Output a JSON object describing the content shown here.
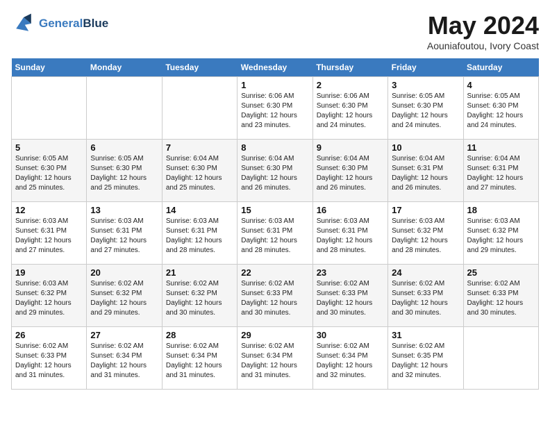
{
  "logo": {
    "line1": "General",
    "line2": "Blue"
  },
  "title": "May 2024",
  "location": "Aouniafoutou, Ivory Coast",
  "days_of_week": [
    "Sunday",
    "Monday",
    "Tuesday",
    "Wednesday",
    "Thursday",
    "Friday",
    "Saturday"
  ],
  "weeks": [
    [
      {
        "day": "",
        "detail": ""
      },
      {
        "day": "",
        "detail": ""
      },
      {
        "day": "",
        "detail": ""
      },
      {
        "day": "1",
        "detail": "Sunrise: 6:06 AM\nSunset: 6:30 PM\nDaylight: 12 hours\nand 23 minutes."
      },
      {
        "day": "2",
        "detail": "Sunrise: 6:06 AM\nSunset: 6:30 PM\nDaylight: 12 hours\nand 24 minutes."
      },
      {
        "day": "3",
        "detail": "Sunrise: 6:05 AM\nSunset: 6:30 PM\nDaylight: 12 hours\nand 24 minutes."
      },
      {
        "day": "4",
        "detail": "Sunrise: 6:05 AM\nSunset: 6:30 PM\nDaylight: 12 hours\nand 24 minutes."
      }
    ],
    [
      {
        "day": "5",
        "detail": "Sunrise: 6:05 AM\nSunset: 6:30 PM\nDaylight: 12 hours\nand 25 minutes."
      },
      {
        "day": "6",
        "detail": "Sunrise: 6:05 AM\nSunset: 6:30 PM\nDaylight: 12 hours\nand 25 minutes."
      },
      {
        "day": "7",
        "detail": "Sunrise: 6:04 AM\nSunset: 6:30 PM\nDaylight: 12 hours\nand 25 minutes."
      },
      {
        "day": "8",
        "detail": "Sunrise: 6:04 AM\nSunset: 6:30 PM\nDaylight: 12 hours\nand 26 minutes."
      },
      {
        "day": "9",
        "detail": "Sunrise: 6:04 AM\nSunset: 6:30 PM\nDaylight: 12 hours\nand 26 minutes."
      },
      {
        "day": "10",
        "detail": "Sunrise: 6:04 AM\nSunset: 6:31 PM\nDaylight: 12 hours\nand 26 minutes."
      },
      {
        "day": "11",
        "detail": "Sunrise: 6:04 AM\nSunset: 6:31 PM\nDaylight: 12 hours\nand 27 minutes."
      }
    ],
    [
      {
        "day": "12",
        "detail": "Sunrise: 6:03 AM\nSunset: 6:31 PM\nDaylight: 12 hours\nand 27 minutes."
      },
      {
        "day": "13",
        "detail": "Sunrise: 6:03 AM\nSunset: 6:31 PM\nDaylight: 12 hours\nand 27 minutes."
      },
      {
        "day": "14",
        "detail": "Sunrise: 6:03 AM\nSunset: 6:31 PM\nDaylight: 12 hours\nand 28 minutes."
      },
      {
        "day": "15",
        "detail": "Sunrise: 6:03 AM\nSunset: 6:31 PM\nDaylight: 12 hours\nand 28 minutes."
      },
      {
        "day": "16",
        "detail": "Sunrise: 6:03 AM\nSunset: 6:31 PM\nDaylight: 12 hours\nand 28 minutes."
      },
      {
        "day": "17",
        "detail": "Sunrise: 6:03 AM\nSunset: 6:32 PM\nDaylight: 12 hours\nand 28 minutes."
      },
      {
        "day": "18",
        "detail": "Sunrise: 6:03 AM\nSunset: 6:32 PM\nDaylight: 12 hours\nand 29 minutes."
      }
    ],
    [
      {
        "day": "19",
        "detail": "Sunrise: 6:03 AM\nSunset: 6:32 PM\nDaylight: 12 hours\nand 29 minutes."
      },
      {
        "day": "20",
        "detail": "Sunrise: 6:02 AM\nSunset: 6:32 PM\nDaylight: 12 hours\nand 29 minutes."
      },
      {
        "day": "21",
        "detail": "Sunrise: 6:02 AM\nSunset: 6:32 PM\nDaylight: 12 hours\nand 30 minutes."
      },
      {
        "day": "22",
        "detail": "Sunrise: 6:02 AM\nSunset: 6:33 PM\nDaylight: 12 hours\nand 30 minutes."
      },
      {
        "day": "23",
        "detail": "Sunrise: 6:02 AM\nSunset: 6:33 PM\nDaylight: 12 hours\nand 30 minutes."
      },
      {
        "day": "24",
        "detail": "Sunrise: 6:02 AM\nSunset: 6:33 PM\nDaylight: 12 hours\nand 30 minutes."
      },
      {
        "day": "25",
        "detail": "Sunrise: 6:02 AM\nSunset: 6:33 PM\nDaylight: 12 hours\nand 30 minutes."
      }
    ],
    [
      {
        "day": "26",
        "detail": "Sunrise: 6:02 AM\nSunset: 6:33 PM\nDaylight: 12 hours\nand 31 minutes."
      },
      {
        "day": "27",
        "detail": "Sunrise: 6:02 AM\nSunset: 6:34 PM\nDaylight: 12 hours\nand 31 minutes."
      },
      {
        "day": "28",
        "detail": "Sunrise: 6:02 AM\nSunset: 6:34 PM\nDaylight: 12 hours\nand 31 minutes."
      },
      {
        "day": "29",
        "detail": "Sunrise: 6:02 AM\nSunset: 6:34 PM\nDaylight: 12 hours\nand 31 minutes."
      },
      {
        "day": "30",
        "detail": "Sunrise: 6:02 AM\nSunset: 6:34 PM\nDaylight: 12 hours\nand 32 minutes."
      },
      {
        "day": "31",
        "detail": "Sunrise: 6:02 AM\nSunset: 6:35 PM\nDaylight: 12 hours\nand 32 minutes."
      },
      {
        "day": "",
        "detail": ""
      }
    ]
  ]
}
